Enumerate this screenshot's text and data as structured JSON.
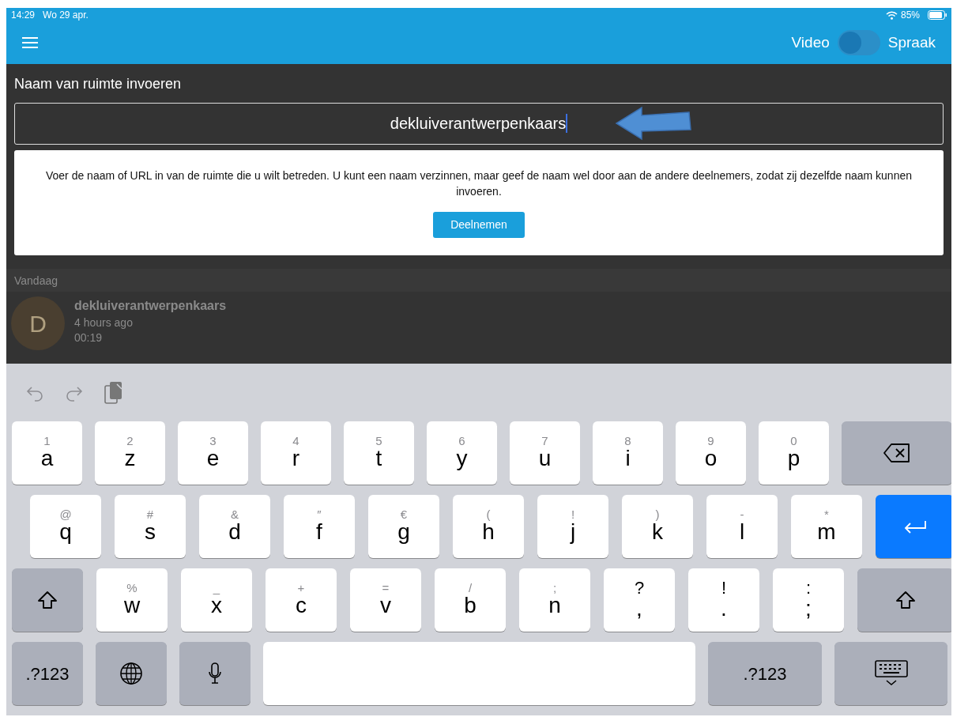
{
  "status_bar": {
    "time": "14:29",
    "date": "Wo 29 apr.",
    "battery": "85%"
  },
  "header": {
    "left_label": "Video",
    "right_label": "Spraak",
    "toggle": {
      "on": false
    }
  },
  "room": {
    "label": "Naam van ruimte invoeren",
    "value": "dekluiverantwerpenkaars",
    "help": "Voer de naam of URL in van de ruimte die u wilt betreden. U kunt een naam verzinnen, maar geef de naam wel door aan de andere deelnemers, zodat zij dezelfde naam kunnen invoeren.",
    "button": "Deelnemen"
  },
  "history": {
    "section": "Vandaag",
    "items": [
      {
        "initial": "D",
        "title": "dekluiverantwerpenkaars",
        "time": "4 hours ago",
        "duration": "00:19"
      }
    ]
  },
  "keyboard": {
    "rows": [
      [
        {
          "kind": "letter",
          "hint": "1",
          "label": "a"
        },
        {
          "kind": "letter",
          "hint": "2",
          "label": "z"
        },
        {
          "kind": "letter",
          "hint": "3",
          "label": "e"
        },
        {
          "kind": "letter",
          "hint": "4",
          "label": "r"
        },
        {
          "kind": "letter",
          "hint": "5",
          "label": "t"
        },
        {
          "kind": "letter",
          "hint": "6",
          "label": "y"
        },
        {
          "kind": "letter",
          "hint": "7",
          "label": "u"
        },
        {
          "kind": "letter",
          "hint": "8",
          "label": "i"
        },
        {
          "kind": "letter",
          "hint": "9",
          "label": "o"
        },
        {
          "kind": "letter",
          "hint": "0",
          "label": "p"
        },
        {
          "kind": "backspace"
        }
      ],
      [
        {
          "kind": "letter",
          "hint": "@",
          "label": "q"
        },
        {
          "kind": "letter",
          "hint": "#",
          "label": "s"
        },
        {
          "kind": "letter",
          "hint": "&",
          "label": "d"
        },
        {
          "kind": "letter",
          "hint": "″",
          "label": "f"
        },
        {
          "kind": "letter",
          "hint": "€",
          "label": "g"
        },
        {
          "kind": "letter",
          "hint": "(",
          "label": "h"
        },
        {
          "kind": "letter",
          "hint": "!",
          "label": "j"
        },
        {
          "kind": "letter",
          "hint": ")",
          "label": "k"
        },
        {
          "kind": "letter",
          "hint": "-",
          "label": "l"
        },
        {
          "kind": "letter",
          "hint": "*",
          "label": "m"
        },
        {
          "kind": "return"
        }
      ],
      [
        {
          "kind": "shift"
        },
        {
          "kind": "letter",
          "hint": "%",
          "label": "w"
        },
        {
          "kind": "letter",
          "hint": "_",
          "label": "x"
        },
        {
          "kind": "letter",
          "hint": "+",
          "label": "c"
        },
        {
          "kind": "letter",
          "hint": "=",
          "label": "v"
        },
        {
          "kind": "letter",
          "hint": "/",
          "label": "b"
        },
        {
          "kind": "letter",
          "hint": ";",
          "label": "n"
        },
        {
          "kind": "punct",
          "hint": "?",
          "label": ","
        },
        {
          "kind": "punct",
          "hint": "!",
          "label": "."
        },
        {
          "kind": "punct",
          "hint": ":",
          "label": ";"
        },
        {
          "kind": "shift"
        }
      ],
      [
        {
          "kind": "mode",
          "label": ".?123"
        },
        {
          "kind": "globe"
        },
        {
          "kind": "mic"
        },
        {
          "kind": "space"
        },
        {
          "kind": "mode",
          "label": ".?123"
        },
        {
          "kind": "dismiss"
        }
      ]
    ]
  }
}
